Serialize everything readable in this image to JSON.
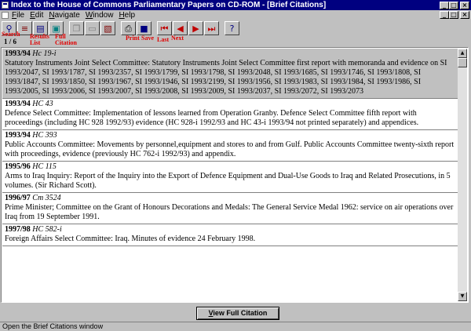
{
  "window": {
    "title": "Index to the House of Commons Parliamentary Papers on CD-ROM - [Brief Citations]",
    "controls": {
      "minimize": "_",
      "maximize": "□",
      "close": "×"
    }
  },
  "menu": {
    "items": [
      {
        "label": "File",
        "accel": "F",
        "rest": "ile"
      },
      {
        "label": "Edit",
        "accel": "E",
        "rest": "dit"
      },
      {
        "label": "Navigate",
        "accel": "N",
        "rest": "avigate"
      },
      {
        "label": "Window",
        "accel": "W",
        "rest": "indow"
      },
      {
        "label": "Help",
        "accel": "H",
        "rest": "elp"
      }
    ]
  },
  "toolbar": {
    "labels": {
      "search": "Search",
      "results_list": "Results\nList",
      "full_citation": "Full\nCitation",
      "print": "Print",
      "save": "Save",
      "last": "Last",
      "next": "Next"
    },
    "counter": "1 / 6"
  },
  "records": [
    {
      "year": "1993/94",
      "ref": "Hc 19-i",
      "text": "Statutory Instruments Joint Select Committee: Statutory Instruments Joint Select Committee first report with memoranda and evidence on SI 1993/2047, SI 1993/1787, SI 1993/2357, SI 1993/1799, SI 1993/1798, SI 1993/2048, SI 1993/1685, SI 1993/1746, SI 1993/1808, SI 1993/1847, SI 1993/1850, SI 1993/1967, SI 1993/1946, SI 1993/2199, SI 1993/1956, SI 1993/1983, SI 1993/1984, SI 1993/1986, SI 1993/2005, SI 1993/2006, SI 1993/2007, SI 1993/2008, SI 1993/2009, SI 1993/2037, SI 1993/2072, SI 1993/2073",
      "selected": true
    },
    {
      "year": "1993/94",
      "ref": "HC 43",
      "text": "Defence Select Committee: Implementation of lessons learned from Operation Granby. Defence Select Committee fifth report with proceedings (including HC 928 1992/93) evidence (HC 928-i 1992/93 and HC 43-i 1993/94 not printed separately) and appendices.",
      "selected": false
    },
    {
      "year": "1993/94",
      "ref": "HC 393",
      "text": "Public Accounts Committee: Movements by personnel,equipment and stores to and from Gulf. Public Accounts Committee twenty-sixth report with proceedings, evidence (previously HC 762-i 1992/93) and appendix.",
      "selected": false
    },
    {
      "year": "1995/96",
      "ref": "HC 115",
      "text": "Arms to Iraq Inquiry: Report of the Inquiry into the Export of Defence Equipment and Dual-Use Goods to Iraq and Related Prosecutions, in 5 volumes. (Sir Richard Scott).",
      "selected": false
    },
    {
      "year": "1996/97",
      "ref": "Cm 3524",
      "text": "Prime Minister; Committee on the Grant of Honours Decorations and Medals: The General Service Medal 1962: service on air operations over Iraq from 19 September 1991.",
      "selected": false
    },
    {
      "year": "1997/98",
      "ref": "HC 582-i",
      "text": "Foreign Affairs Select Committee: Iraq. Minutes of evidence 24 February 1998.",
      "selected": false
    }
  ],
  "buttons": {
    "view_full_citation": "View Full Citation",
    "view_accel": "V",
    "view_rest": "iew Full Citation"
  },
  "status": {
    "text": "Open the Brief Citations window"
  },
  "colors": {
    "titlebar": "#000080",
    "label_red": "#e00000",
    "chrome": "#c0c0c0",
    "selected_row": "#c0c0c0"
  }
}
